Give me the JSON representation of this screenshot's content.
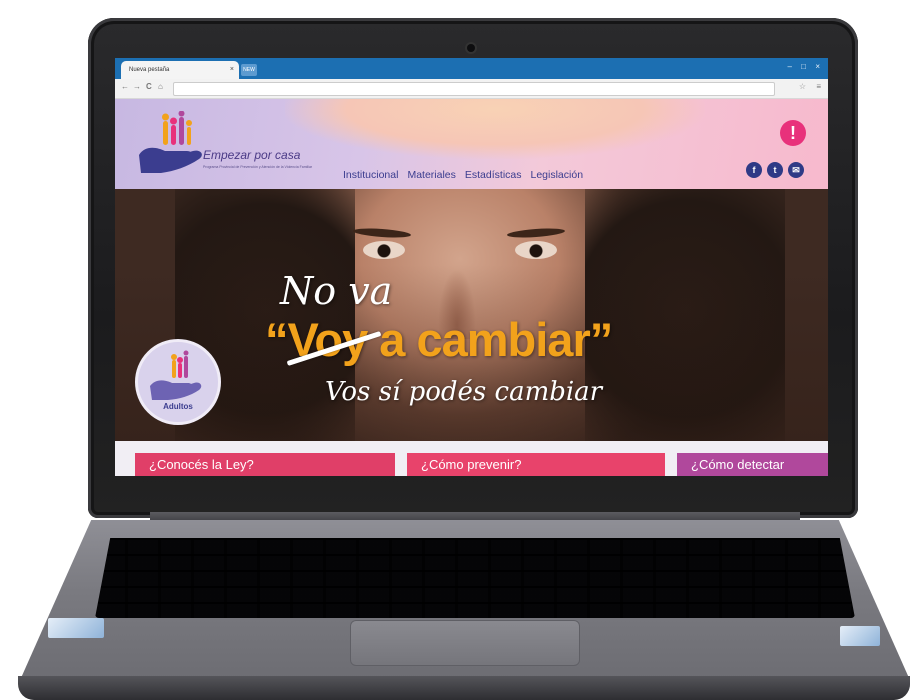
{
  "browser": {
    "tab_title": "Nueva pestaña",
    "tab_close": "×",
    "new_tab": "NEW",
    "window_controls": [
      "–",
      "□",
      "×"
    ],
    "nav_buttons": [
      "←",
      "→",
      "C",
      "⌂"
    ],
    "star": "☆",
    "menu": "≡"
  },
  "site": {
    "brand_name": "Empezar por casa",
    "brand_subtitle": "Programa Provincial de Prevención y Atención de la Violencia Familiar",
    "nav_items": [
      "Institucional",
      "Materiales",
      "Estadísticas",
      "Legislación"
    ],
    "alert_symbol": "!",
    "social_icons": [
      "f",
      "t",
      "✉"
    ],
    "colors": {
      "brand_purple": "#3b3d8f",
      "accent_orange": "#f2a21b",
      "alert_pink": "#e8317b"
    }
  },
  "hero": {
    "line1": "No va",
    "line2": "“Voy a cambiar”",
    "line3": "Vos sí podés cambiar",
    "badge_label": "Adultos"
  },
  "cards": [
    {
      "label": "¿Conocés la Ley?",
      "color": "#e03f68"
    },
    {
      "label": "¿Cómo prevenir?",
      "color": "#e8436b"
    },
    {
      "label": "¿Cómo detectar",
      "color": "#b0489c"
    }
  ]
}
